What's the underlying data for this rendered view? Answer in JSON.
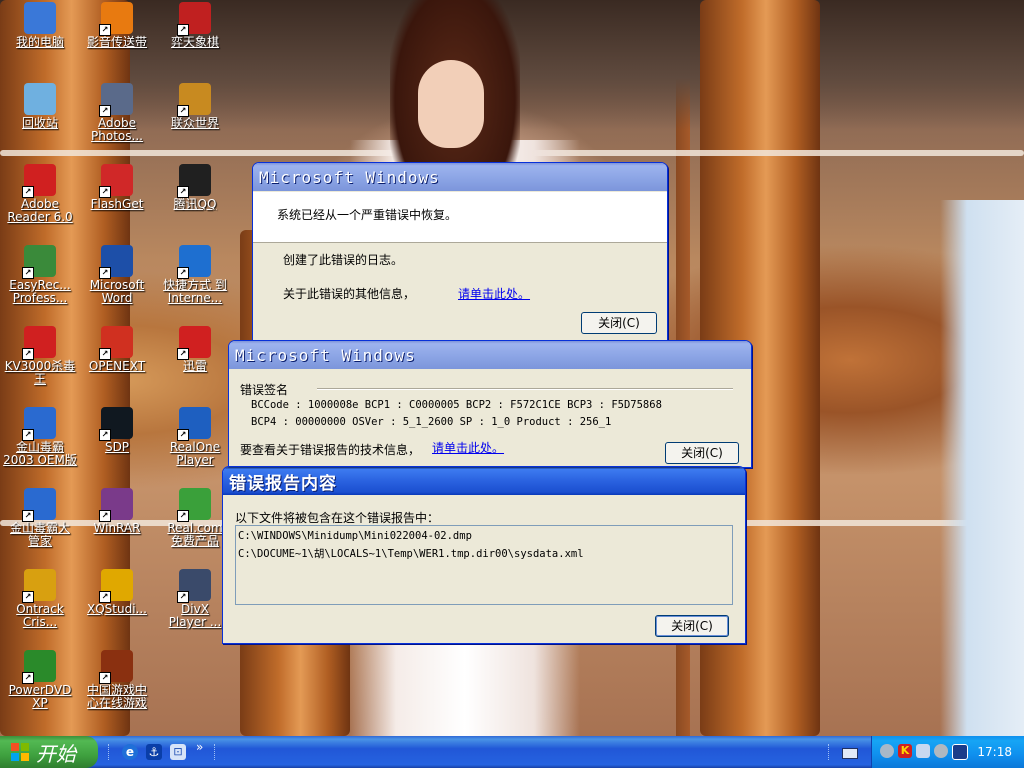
{
  "desktop": {
    "icons": [
      {
        "label": "我的电脑",
        "icon": "my-computer-icon",
        "color": "#3a78d8"
      },
      {
        "label": "影音传送带",
        "icon": "netants-icon",
        "color": "#e87a10"
      },
      {
        "label": "弈天象棋",
        "icon": "chess-icon",
        "color": "#c02020"
      },
      {
        "label": "回收站",
        "icon": "recycle-bin-icon",
        "color": "#6fb0e0"
      },
      {
        "label": "Adobe\nPhotos...",
        "icon": "photoshop-icon",
        "color": "#5a6a8a"
      },
      {
        "label": "联众世界",
        "icon": "ourgame-icon",
        "color": "#c88a20"
      },
      {
        "label": "Adobe\nReader 6.0",
        "icon": "acrobat-icon",
        "color": "#d02020"
      },
      {
        "label": "FlashGet",
        "icon": "flashget-icon",
        "color": "#d02828"
      },
      {
        "label": "腾讯QQ",
        "icon": "qq-icon",
        "color": "#202020"
      },
      {
        "label": "EasyRec...\nProfess...",
        "icon": "easyrecovery-icon",
        "color": "#3a8a3a"
      },
      {
        "label": "Microsoft\nWord",
        "icon": "word-icon",
        "color": "#1d4fa8"
      },
      {
        "label": "快捷方式 到\nInterne...",
        "icon": "internet-explorer-icon",
        "color": "#1e6fd0"
      },
      {
        "label": "KV3000杀毒\n王",
        "icon": "kv3000-icon",
        "color": "#d02020"
      },
      {
        "label": "OPENEXT",
        "icon": "octopus-icon",
        "color": "#d03020"
      },
      {
        "label": "迅雷",
        "icon": "joystick-icon",
        "color": "#d02020"
      },
      {
        "label": "金山毒霸\n2003 OEM版",
        "icon": "kingsoft-antivirus-icon",
        "color": "#2a6ad0"
      },
      {
        "label": "SDP",
        "icon": "sdp-icon",
        "color": "#101820"
      },
      {
        "label": "RealOne\nPlayer",
        "icon": "realone-icon",
        "color": "#1e5fc0"
      },
      {
        "label": "金山毒霸大\n管家",
        "icon": "kingsoft-manager-icon",
        "color": "#2a6ad0"
      },
      {
        "label": "WinRAR",
        "icon": "winrar-icon",
        "color": "#7a3a8a"
      },
      {
        "label": "Real.com\n免费产品",
        "icon": "gift-icon",
        "color": "#3aa03a"
      },
      {
        "label": "Ontrack\nCris...",
        "icon": "ontrack-icon",
        "color": "#d8a010"
      },
      {
        "label": "XQStudi...",
        "icon": "xqstudio-icon",
        "color": "#e0a800"
      },
      {
        "label": "DivX\nPlayer ...",
        "icon": "divx-icon",
        "color": "#3a4a6a"
      },
      {
        "label": "PowerDVD\nXP",
        "icon": "powerdvd-icon",
        "color": "#2a8a2a"
      },
      {
        "label": "中国游戏中\n心在线游戏",
        "icon": "game-center-icon",
        "color": "#8a3010"
      }
    ]
  },
  "dialog1": {
    "title": "Microsoft Windows",
    "message": "系统已经从一个严重错误中恢复。",
    "log_text": "创建了此错误的日志。",
    "info_text": "关于此错误的其他信息，",
    "link": "请单击此处。",
    "close": "关闭(C)"
  },
  "dialog2": {
    "title": "Microsoft Windows",
    "section": "错误签名",
    "row1": "BCCode : 1000008e    BCP1 : C0000005    BCP2 : F572C1CE    BCP3 : F5D75868",
    "row2": "BCP4 : 00000000    OSVer : 5_1_2600    SP : 1_0    Product : 256_1",
    "tech_text": "要查看关于错误报告的技术信息，",
    "link": "请单击此处。",
    "close": "关闭(C)"
  },
  "dialog3": {
    "title": "错误报告内容",
    "intro": "以下文件将被包含在这个错误报告中：",
    "files": [
      "C:\\WINDOWS\\Minidump\\Mini022004-02.dmp",
      "C:\\DOCUME~1\\胡\\LOCALS~1\\Temp\\WER1.tmp.dir00\\sysdata.xml"
    ],
    "close": "关闭(C)"
  },
  "taskbar": {
    "start": "开始",
    "quicklaunch": [
      "ie-icon",
      "anchor-icon",
      "desktop-icon"
    ],
    "chevron": "»",
    "clock": "17:18",
    "tray_icons": [
      "network-icon",
      "kv-icon",
      "monitor-icon",
      "speaker-icon",
      "shield-icon"
    ]
  }
}
